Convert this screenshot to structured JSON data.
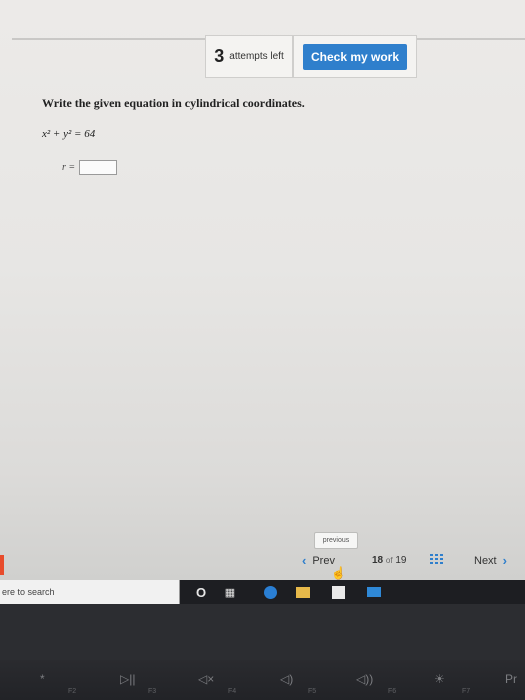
{
  "header": {
    "attempts_count": "3",
    "attempts_text": "attempts left",
    "check_button": "Check my work"
  },
  "question": {
    "prompt": "Write the given equation in cylindrical coordinates.",
    "equation": "x² + y² = 64",
    "answer_label": "r =",
    "answer_value": ""
  },
  "pagination": {
    "tooltip": "previous",
    "prev_label": "Prev",
    "current": "18",
    "of_text": "of",
    "total": "19",
    "next_label": "Next"
  },
  "taskbar": {
    "search_placeholder": "ere to search"
  },
  "keyboard": {
    "keys": [
      "*",
      "▷||",
      "◁×",
      "◁)",
      "◁))",
      "☀",
      "Pr"
    ],
    "fn_labels": [
      "F2",
      "F3",
      "F4",
      "F5",
      "F6",
      "F7"
    ]
  }
}
